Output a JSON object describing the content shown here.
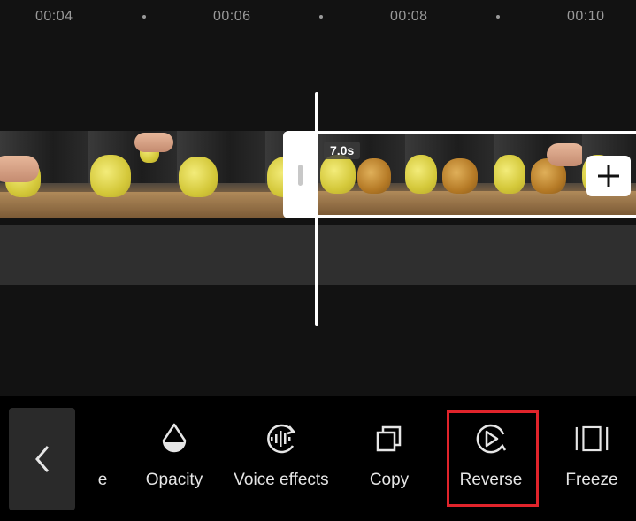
{
  "ruler": {
    "labels": [
      "00:04",
      "00:06",
      "00:08",
      "00:10"
    ]
  },
  "timeline": {
    "clip_duration": "7.0s"
  },
  "toolbar": {
    "partial_label": "e",
    "tools": [
      {
        "label": "Opacity",
        "icon": "opacity-icon"
      },
      {
        "label": "Voice effects",
        "icon": "voice-effects-icon"
      },
      {
        "label": "Copy",
        "icon": "copy-icon"
      },
      {
        "label": "Reverse",
        "icon": "reverse-icon"
      },
      {
        "label": "Freeze",
        "icon": "freeze-icon"
      }
    ]
  },
  "colors": {
    "highlight": "#e0242b",
    "background": "#121212",
    "toolbar": "#000000"
  }
}
